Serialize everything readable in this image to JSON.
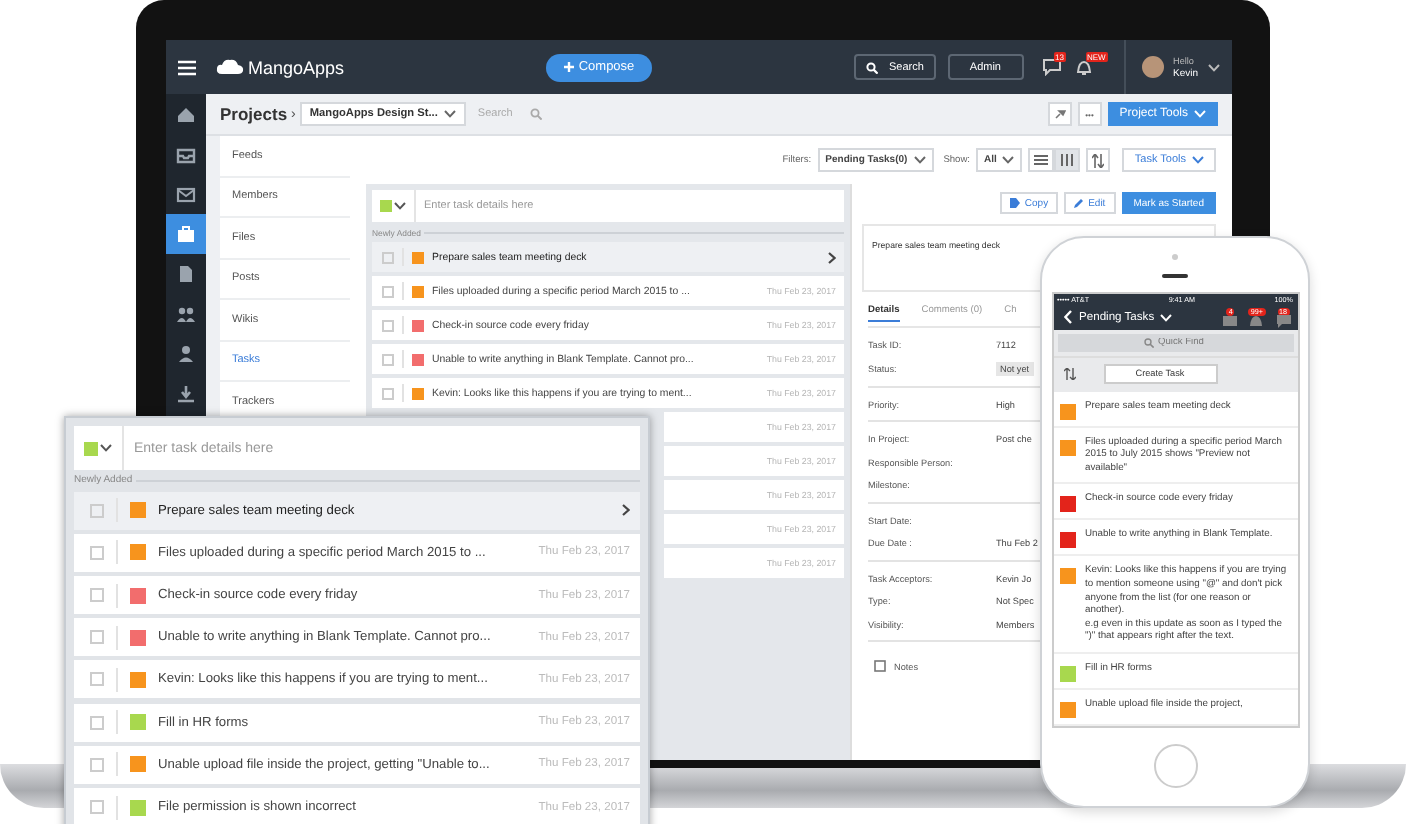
{
  "laptop": {
    "topbar": {
      "logo": "MangoApps",
      "compose": "Compose",
      "search": "Search",
      "admin": "Admin",
      "badges": [
        {
          "kind": "chat",
          "count": "13"
        },
        {
          "kind": "bell",
          "count": "NEW"
        }
      ],
      "greeting": "Hello",
      "user": "Kevin"
    },
    "rail": [
      {
        "kind": "home",
        "selected": false
      },
      {
        "kind": "inbox",
        "selected": false
      },
      {
        "kind": "mail",
        "selected": false
      },
      {
        "kind": "briefcase",
        "selected": true
      },
      {
        "kind": "document",
        "selected": false
      },
      {
        "kind": "people",
        "selected": false
      },
      {
        "kind": "person",
        "selected": false
      },
      {
        "kind": "download",
        "selected": false
      }
    ],
    "breadcrumb": {
      "title": "Projects",
      "separator": "›",
      "project": "MangoApps Design St...",
      "search_placeholder": "Search",
      "project_tools": "Project Tools",
      "more": "•••"
    },
    "sidebar": {
      "items": [
        {
          "label": "Feeds",
          "selected": false
        },
        {
          "label": "Members",
          "selected": false
        },
        {
          "label": "Files",
          "selected": false
        },
        {
          "label": "Posts",
          "selected": false
        },
        {
          "label": "Wikis",
          "selected": false
        },
        {
          "label": "Tasks",
          "selected": true
        },
        {
          "label": "Trackers",
          "selected": false
        }
      ]
    },
    "filters": {
      "label": "Filters:",
      "value": "Pending Tasks(0)",
      "show_label": "Show:",
      "show_value": "All",
      "task_tools": "Task Tools"
    },
    "task_list": {
      "placeholder": "Enter task details here",
      "section": "Newly Added",
      "rows": [
        {
          "title": "Prepare sales team meeting deck",
          "color": "#f7941d",
          "selected": true
        },
        {
          "title": "Files uploaded during a specific period March 2015 to ...",
          "date": "Thu Feb 23, 2017",
          "color": "#f7941d",
          "selected": false
        },
        {
          "title": "Check-in source code every friday",
          "date": "Thu Feb 23, 2017",
          "color": "#f26d6d",
          "selected": false
        },
        {
          "title": "Unable to write anything in Blank Template. Cannot pro...",
          "date": "Thu Feb 23, 2017",
          "color": "#f26d6d",
          "selected": false
        },
        {
          "title": "Kevin: Looks like this happens if you are trying to ment...",
          "date": "Thu Feb 23, 2017",
          "color": "#f7941d",
          "selected": false
        },
        {
          "date": "Thu Feb 23, 2017",
          "selected": false
        },
        {
          "date": "Thu Feb 23, 2017",
          "selected": false
        },
        {
          "date": "Thu Feb 23, 2017",
          "selected": false
        },
        {
          "date": "Thu Feb 23, 2017",
          "selected": false
        },
        {
          "date": "Thu Feb 23, 2017",
          "selected": false
        }
      ]
    },
    "details": {
      "buttons": [
        {
          "kind": "copy",
          "label": "Copy"
        },
        {
          "kind": "edit",
          "label": "Edit"
        },
        {
          "kind": "primary",
          "label": "Mark as Started"
        }
      ],
      "description": "Prepare sales team meeting deck",
      "tabs": [
        {
          "label": "Details",
          "selected": true
        },
        {
          "label": "Comments (0)",
          "selected": false
        },
        {
          "label": "Ch",
          "selected": false
        }
      ],
      "groups": [
        {
          "fields": [
            {
              "label": "Task ID:",
              "value": "7112",
              "kind": "text"
            },
            {
              "label": "Status:",
              "value": "Not yet",
              "kind": "chip"
            }
          ]
        },
        {
          "fields": [
            {
              "label": "Priority:",
              "value": "High",
              "kind": "text"
            }
          ]
        },
        {
          "fields": [
            {
              "label": "In Project:",
              "value": "Post che",
              "kind": "text"
            },
            {
              "label": "Responsible Person:",
              "kind": "text"
            },
            {
              "label": "Milestone:",
              "kind": "text"
            }
          ]
        },
        {
          "fields": [
            {
              "label": "Start Date:",
              "kind": "text"
            },
            {
              "label": "Due Date :",
              "value": "Thu Feb 2",
              "kind": "text"
            }
          ]
        },
        {
          "fields": [
            {
              "label": "Task Acceptors:",
              "value": "Kevin Jo",
              "kind": "text"
            },
            {
              "label": "Type:",
              "value": "Not Spec",
              "kind": "text"
            },
            {
              "label": "Visibility:",
              "value": "Members",
              "kind": "text"
            }
          ]
        }
      ],
      "notes": "Notes"
    }
  },
  "overlay": {
    "placeholder": "Enter task details here",
    "section": "Newly Added",
    "rows": [
      {
        "title": "Prepare sales team meeting deck",
        "color": "#f7941d",
        "selected": true
      },
      {
        "title": "Files uploaded during a specific period March 2015 to ...",
        "date": "Thu Feb 23, 2017",
        "color": "#f7941d",
        "selected": false
      },
      {
        "title": "Check-in source code every friday",
        "date": "Thu Feb 23, 2017",
        "color": "#f26d6d",
        "selected": false
      },
      {
        "title": "Unable to write anything in Blank Template. Cannot pro...",
        "date": "Thu Feb 23, 2017",
        "color": "#f26d6d",
        "selected": false
      },
      {
        "title": "Kevin: Looks like this happens if you are trying to ment...",
        "date": "Thu Feb 23, 2017",
        "color": "#f7941d",
        "selected": false
      },
      {
        "title": "Fill in HR forms",
        "date": "Thu Feb 23, 2017",
        "color": "#a8d84e",
        "selected": false
      },
      {
        "title": "Unable upload file inside the project, getting \"Unable to...",
        "date": "Thu Feb 23, 2017",
        "color": "#f7941d",
        "selected": false
      },
      {
        "title": "File permission is shown incorrect",
        "date": "Thu Feb 23, 2017",
        "color": "#a8d84e",
        "selected": false
      }
    ]
  },
  "phone": {
    "carrier": "••••• AT&T",
    "time": "9:41 AM",
    "battery": "100%",
    "title": "Pending Tasks",
    "badges": [
      {
        "kind": "mail",
        "count": "4"
      },
      {
        "kind": "bell",
        "count": "99+"
      },
      {
        "kind": "chat",
        "count": "18"
      }
    ],
    "search_placeholder": "Quick Find",
    "create": "Create Task",
    "items": [
      {
        "title": "Prepare sales team meeting deck",
        "color": "#f7941d"
      },
      {
        "title": "Files uploaded during a specific period March 2015 to July 2015 shows \"Preview not available\"",
        "color": "#f7941d"
      },
      {
        "title": "Check-in source code every friday",
        "color": "#e3241b"
      },
      {
        "title": "Unable to write anything in Blank Template.",
        "color": "#e3241b"
      },
      {
        "title": "Kevin: Looks like this happens if you are trying to mention someone using \"@\" and don't pick anyone from the list (for one reason or another).\ne.g even in this update as soon as I typed the \")\" that appears right after the text.",
        "color": "#f7941d"
      },
      {
        "title": "Fill in HR forms",
        "color": "#a8d84e"
      },
      {
        "title": "Unable upload file inside the project,",
        "color": "#f7941d"
      }
    ]
  }
}
